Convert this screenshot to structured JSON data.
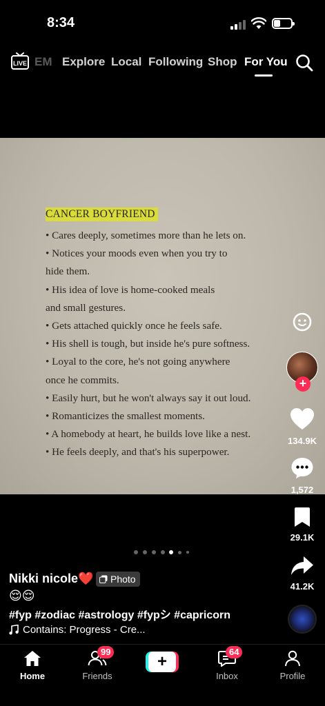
{
  "status_bar": {
    "time": "8:34"
  },
  "top_nav": {
    "live_label": "LIVE",
    "tabs": [
      {
        "label": "EM",
        "state": "faded"
      },
      {
        "label": "Explore"
      },
      {
        "label": "Local"
      },
      {
        "label": "Following"
      },
      {
        "label": "Shop"
      },
      {
        "label": "For You",
        "state": "active"
      }
    ],
    "search_icon": "search-icon"
  },
  "photo": {
    "heading": "CANCER BOYFRIEND",
    "lines": [
      "• Cares deeply, sometimes more than he lets on.",
      "• Notices your moods even when you try to",
      "hide them.",
      "• His idea of love is home-cooked meals",
      "and small gestures.",
      "• Gets attached quickly once he feels safe.",
      "• His shell is tough, but inside he's pure softness.",
      "• Loyal to the core, he's not going anywhere",
      "once he commits.",
      "• Easily hurt, but he won't always say it out loud.",
      "• Romanticizes the smallest moments.",
      "• A homebody at heart, he builds love like a nest.",
      "• He feels deeply, and that's his superpower."
    ],
    "highlight_color": "#d9dc3a"
  },
  "rail": {
    "likes": "134.9K",
    "comments": "1,572",
    "saves": "29.1K",
    "shares": "41.2K"
  },
  "carousel": {
    "total": 7,
    "active_index": 4
  },
  "caption": {
    "author": "Nikki nicole❤️",
    "photo_badge": "Photo",
    "emoji": "😌😌",
    "hashtags": "#fyp #zodiac #astrology #fypシ #capricorn",
    "music": "Contains: Progress - Cre..."
  },
  "bottom_nav": {
    "home": "Home",
    "friends": "Friends",
    "friends_badge": "99",
    "inbox": "Inbox",
    "inbox_badge": "64",
    "profile": "Profile"
  },
  "colors": {
    "accent": "#fe2c55",
    "cyan": "#25f4ee"
  }
}
